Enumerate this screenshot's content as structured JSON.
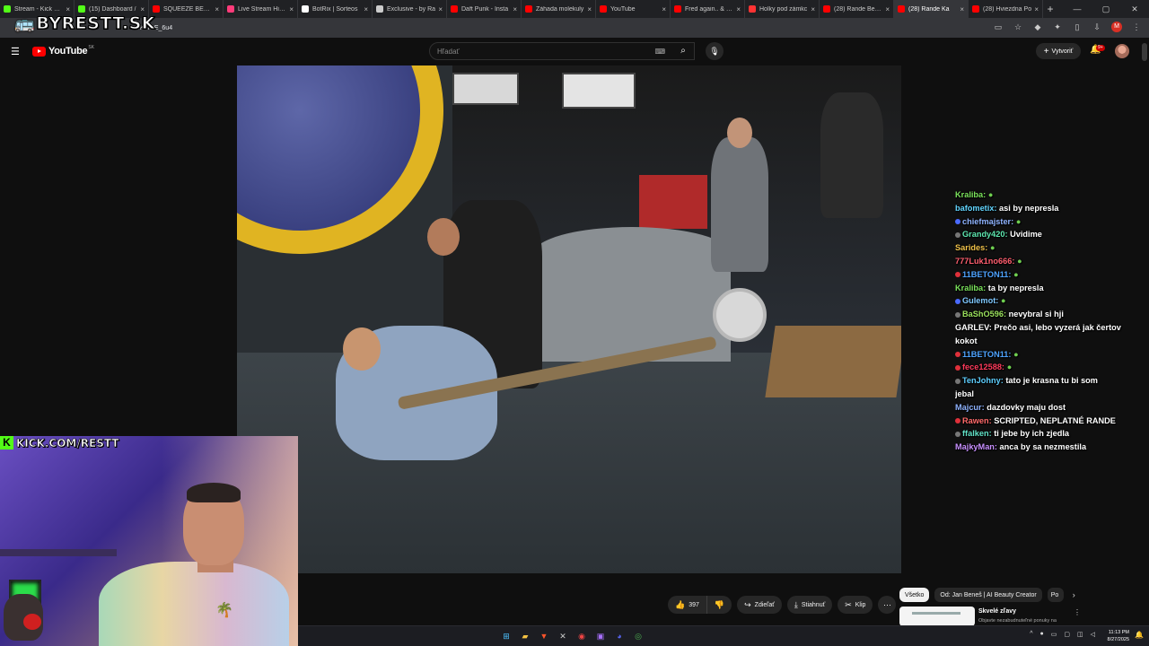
{
  "tabs": [
    {
      "title": "Stream - Kick Das",
      "color": "#53fc18"
    },
    {
      "title": "(15) Dashboard /",
      "color": "#53fc18"
    },
    {
      "title": "SQUEEZE BENZ D",
      "color": "#ff0000"
    },
    {
      "title": "Live Stream Histo",
      "color": "#ff3b7a"
    },
    {
      "title": "BotRix | Sorteos",
      "color": "#ffffff"
    },
    {
      "title": "Exclusive - by Ra",
      "color": "#cccccc"
    },
    {
      "title": "Daft Punk - Insta",
      "color": "#ff0000"
    },
    {
      "title": "Záhada molekuly",
      "color": "#ff0000"
    },
    {
      "title": "YouTube",
      "color": "#ff0000"
    },
    {
      "title": "Fred again.. & Ba",
      "color": "#ff0000"
    },
    {
      "title": "Holky pod zámkc",
      "color": "#ff3333"
    },
    {
      "title": "(28) Rande Benny",
      "color": "#ff0000"
    },
    {
      "title": "(28) Rande Ka",
      "color": "#ff0000",
      "active": true
    },
    {
      "title": "(28) Hviezdna Po",
      "color": "#ff0000"
    }
  ],
  "browser": {
    "url": "0K7khE_6u4",
    "profile_initial": "M"
  },
  "overlay_logo": {
    "text": "BYRESTT.SK",
    "icon": "bus-icon"
  },
  "youtube": {
    "logo_text": "YouTube",
    "region": "SK",
    "search_placeholder": "Hľadať",
    "create_label": "Vytvoriť",
    "notification_badge": "9+"
  },
  "chat": [
    {
      "user": "Kraliba:",
      "msg": "",
      "color": "#7be35c",
      "badge": "",
      "emote": true
    },
    {
      "user": "bafometix:",
      "msg": "asi by nepresla",
      "color": "#63d6ff",
      "badge": ""
    },
    {
      "user": "chiefmajster:",
      "msg": "",
      "color": "#8fb3ff",
      "badge": "#4a6aff",
      "emote": true
    },
    {
      "user": "Grandy420:",
      "msg": "Uvidime",
      "color": "#5ee8b0",
      "badge": "#777777"
    },
    {
      "user": "Sarides:",
      "msg": "",
      "color": "#f0c24a",
      "badge": "",
      "emote": true
    },
    {
      "user": "777Luk1no666:",
      "msg": "",
      "color": "#ff5e6e",
      "badge": "",
      "emote": true
    },
    {
      "user": "11BETON11:",
      "msg": "",
      "color": "#4ea3ff",
      "badge": "#e0303a",
      "emote": true
    },
    {
      "user": "Kraliba:",
      "msg": "ta by nepresla",
      "color": "#7be35c",
      "badge": ""
    },
    {
      "user": "Gulemot:",
      "msg": "",
      "color": "#7fc8ff",
      "badge": "#4a6aff",
      "emote": true
    },
    {
      "user": "BaShO596:",
      "msg": "nevybral si hji",
      "color": "#9ae05c",
      "badge": "#777777"
    },
    {
      "user": "GARLEV:",
      "msg": "Prečo asi, lebo vyzerá jak čertov",
      "color": "#ffffff",
      "badge": ""
    },
    {
      "user": "",
      "msg": "kokot",
      "color": "#ffffff",
      "badge": ""
    },
    {
      "user": "11BETON11:",
      "msg": "",
      "color": "#4ea3ff",
      "badge": "#e0303a",
      "emote": true
    },
    {
      "user": "fece12588:",
      "msg": "",
      "color": "#ff3b5c",
      "badge": "#e0303a",
      "emote": true
    },
    {
      "user": "TenJohny:",
      "msg": "tato je krasna tu bi som",
      "color": "#5ecfff",
      "badge": "#777777"
    },
    {
      "user": "",
      "msg": "jebal",
      "color": "#ffffff",
      "badge": ""
    },
    {
      "user": "Majcur:",
      "msg": "dazdovky maju dost",
      "color": "#8fb3ff",
      "badge": ""
    },
    {
      "user": "Rawen:",
      "msg": "SCRIPTED, NEPLATNÉ RANDE",
      "color": "#ff6a6a",
      "badge": "#e0303a"
    },
    {
      "user": "ffalken:",
      "msg": "ti jebe by ich zjedla",
      "color": "#62e3c8",
      "badge": "#777777"
    },
    {
      "user": "MajkyMan:",
      "msg": "anca by sa nezmestila",
      "color": "#c890ff",
      "badge": ""
    }
  ],
  "webcam": {
    "kick_letter": "K",
    "kick_url": "KICK.COM/RESTT"
  },
  "actions": {
    "like_count": "397",
    "share_label": "Zdieľať",
    "download_label": "Stiahnuť",
    "clip_label": "Klip"
  },
  "chips": {
    "all": "Všetko",
    "from": "Od: Jan Beneš | AI Beauty Creator",
    "cut": "Po"
  },
  "ad": {
    "title": "Skvelé zľavy",
    "subtitle": "Objavte nezabudnuteľné ponuky na"
  },
  "taskbar": {
    "time": "11:13 PM",
    "date": "8/27/2025"
  }
}
